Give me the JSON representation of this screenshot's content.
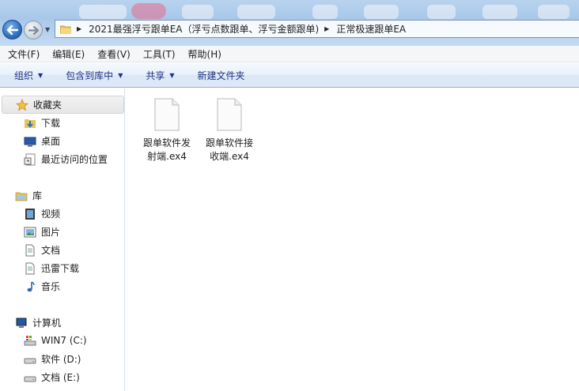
{
  "address": {
    "segments": [
      "2021最强浮亏跟单EA（浮亏点数跟单、浮亏金额跟单)",
      "正常极速跟单EA"
    ]
  },
  "menu": [
    "文件(F)",
    "编辑(E)",
    "查看(V)",
    "工具(T)",
    "帮助(H)"
  ],
  "commands": {
    "organize": "组织",
    "include_in_library": "包含到库中",
    "share": "共享",
    "new_folder": "新建文件夹"
  },
  "nav": {
    "favorites": "收藏夹",
    "downloads": "下载",
    "desktop": "桌面",
    "recent": "最近访问的位置",
    "libraries": "库",
    "videos": "视频",
    "pictures": "图片",
    "documents": "文档",
    "thunder": "迅雷下载",
    "music": "音乐",
    "computer": "计算机",
    "drive_c": "WIN7 (C:)",
    "drive_d": "软件 (D:)",
    "drive_e": "文档 (E:)"
  },
  "files": [
    {
      "line1": "跟单软件发",
      "line2": "射端.ex4"
    },
    {
      "line1": "跟单软件接",
      "line2": "收端.ex4"
    }
  ],
  "colors": {
    "command_text": "#1e3287",
    "selection": "#e6e6e6"
  }
}
